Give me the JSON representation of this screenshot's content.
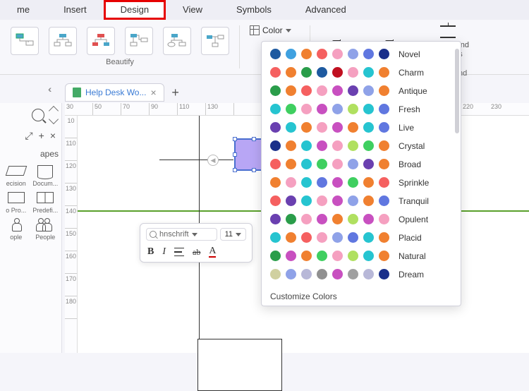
{
  "menu": {
    "home": "me",
    "insert": "Insert",
    "design": "Design",
    "view": "View",
    "symbols": "Symbols",
    "advanced": "Advanced"
  },
  "ribbon": {
    "beautify_label": "Beautify",
    "color_label": "Color",
    "background_label": "ground",
    "borders_headers": [
      "Borders and",
      "Headers"
    ]
  },
  "tab": {
    "title": "Help Desk Wo...",
    "close": "×",
    "new": "+"
  },
  "collapse": "‹‹",
  "leftpanel": {
    "shapes_heading": "apes",
    "tools": {
      "expand": "⤢",
      "plus": "+",
      "close": "×"
    },
    "cells": {
      "precision": "ecision",
      "documents": "Docum...",
      "pro": "o Pro...",
      "predefined": "Predefi...",
      "people1": "ople",
      "people2": "People"
    }
  },
  "hruler": [
    "30",
    "50",
    "70",
    "90",
    "110",
    "130"
  ],
  "far_ruler": [
    "220",
    "230"
  ],
  "vruler": [
    "10",
    "110",
    "120",
    "130",
    "140",
    "150",
    "160",
    "170",
    "180"
  ],
  "arrow_node": "◀",
  "format_bar": {
    "font": "hnschrift",
    "size": "11",
    "bold": "B",
    "italic": "I",
    "strike": "ab",
    "fontcolor": "A"
  },
  "color_schemes": [
    {
      "name": "Novel",
      "colors": [
        "#1e5aa0",
        "#3fa1e0",
        "#f08030",
        "#f56060",
        "#f5a0c0",
        "#8fa2e8",
        "#6077e0",
        "#1a2f8a"
      ]
    },
    {
      "name": "Charm",
      "colors": [
        "#f56060",
        "#f08030",
        "#2a9d4a",
        "#1e5aa0",
        "#c01020",
        "#f5a0c0",
        "#26c4d0",
        "#f08030"
      ]
    },
    {
      "name": "Antique",
      "colors": [
        "#2a9d4a",
        "#f08030",
        "#f56060",
        "#f5a0c0",
        "#c850c0",
        "#6a40b0",
        "#8fa2e8",
        "#f08030"
      ]
    },
    {
      "name": "Fresh",
      "colors": [
        "#26c4d0",
        "#3fcf60",
        "#f5a0c0",
        "#c850c0",
        "#8fa2e8",
        "#b0e060",
        "#26c4d0",
        "#6077e0"
      ]
    },
    {
      "name": "Live",
      "colors": [
        "#6a40b0",
        "#26c4d0",
        "#f08030",
        "#f5a0c0",
        "#c850c0",
        "#f08030",
        "#26c4d0",
        "#6077e0"
      ]
    },
    {
      "name": "Crystal",
      "colors": [
        "#1a2f8a",
        "#f08030",
        "#26c4d0",
        "#c850c0",
        "#f5a0c0",
        "#b0e060",
        "#3fcf60",
        "#f08030"
      ]
    },
    {
      "name": "Broad",
      "colors": [
        "#f56060",
        "#f08030",
        "#26c4d0",
        "#3fcf60",
        "#f5a0c0",
        "#8fa2e8",
        "#6a40b0",
        "#f08030"
      ]
    },
    {
      "name": "Sprinkle",
      "colors": [
        "#f08030",
        "#f5a0c0",
        "#26c4d0",
        "#6077e0",
        "#c850c0",
        "#3fcf60",
        "#f08030",
        "#f56060"
      ]
    },
    {
      "name": "Tranquil",
      "colors": [
        "#f56060",
        "#6a40b0",
        "#26c4d0",
        "#f5a0c0",
        "#c850c0",
        "#8fa2e8",
        "#f08030",
        "#6077e0"
      ]
    },
    {
      "name": "Opulent",
      "colors": [
        "#6a40b0",
        "#2a9d4a",
        "#f5a0c0",
        "#c850c0",
        "#f08030",
        "#b0e060",
        "#c850c0",
        "#f5a0c0"
      ]
    },
    {
      "name": "Placid",
      "colors": [
        "#26c4d0",
        "#f08030",
        "#f56060",
        "#f5a0c0",
        "#8fa2e8",
        "#6077e0",
        "#26c4d0",
        "#f08030"
      ]
    },
    {
      "name": "Natural",
      "colors": [
        "#2a9d4a",
        "#c850c0",
        "#f08030",
        "#3fcf60",
        "#f5a0c0",
        "#b0e060",
        "#26c4d0",
        "#f08030"
      ]
    },
    {
      "name": "Dream",
      "colors": [
        "#d0d0a0",
        "#8fa2e8",
        "#b8b8d8",
        "#909090",
        "#c850c0",
        "#a0a0a0",
        "#b8b8d8",
        "#1a2f8a"
      ]
    }
  ],
  "customize_label": "Customize Colors"
}
